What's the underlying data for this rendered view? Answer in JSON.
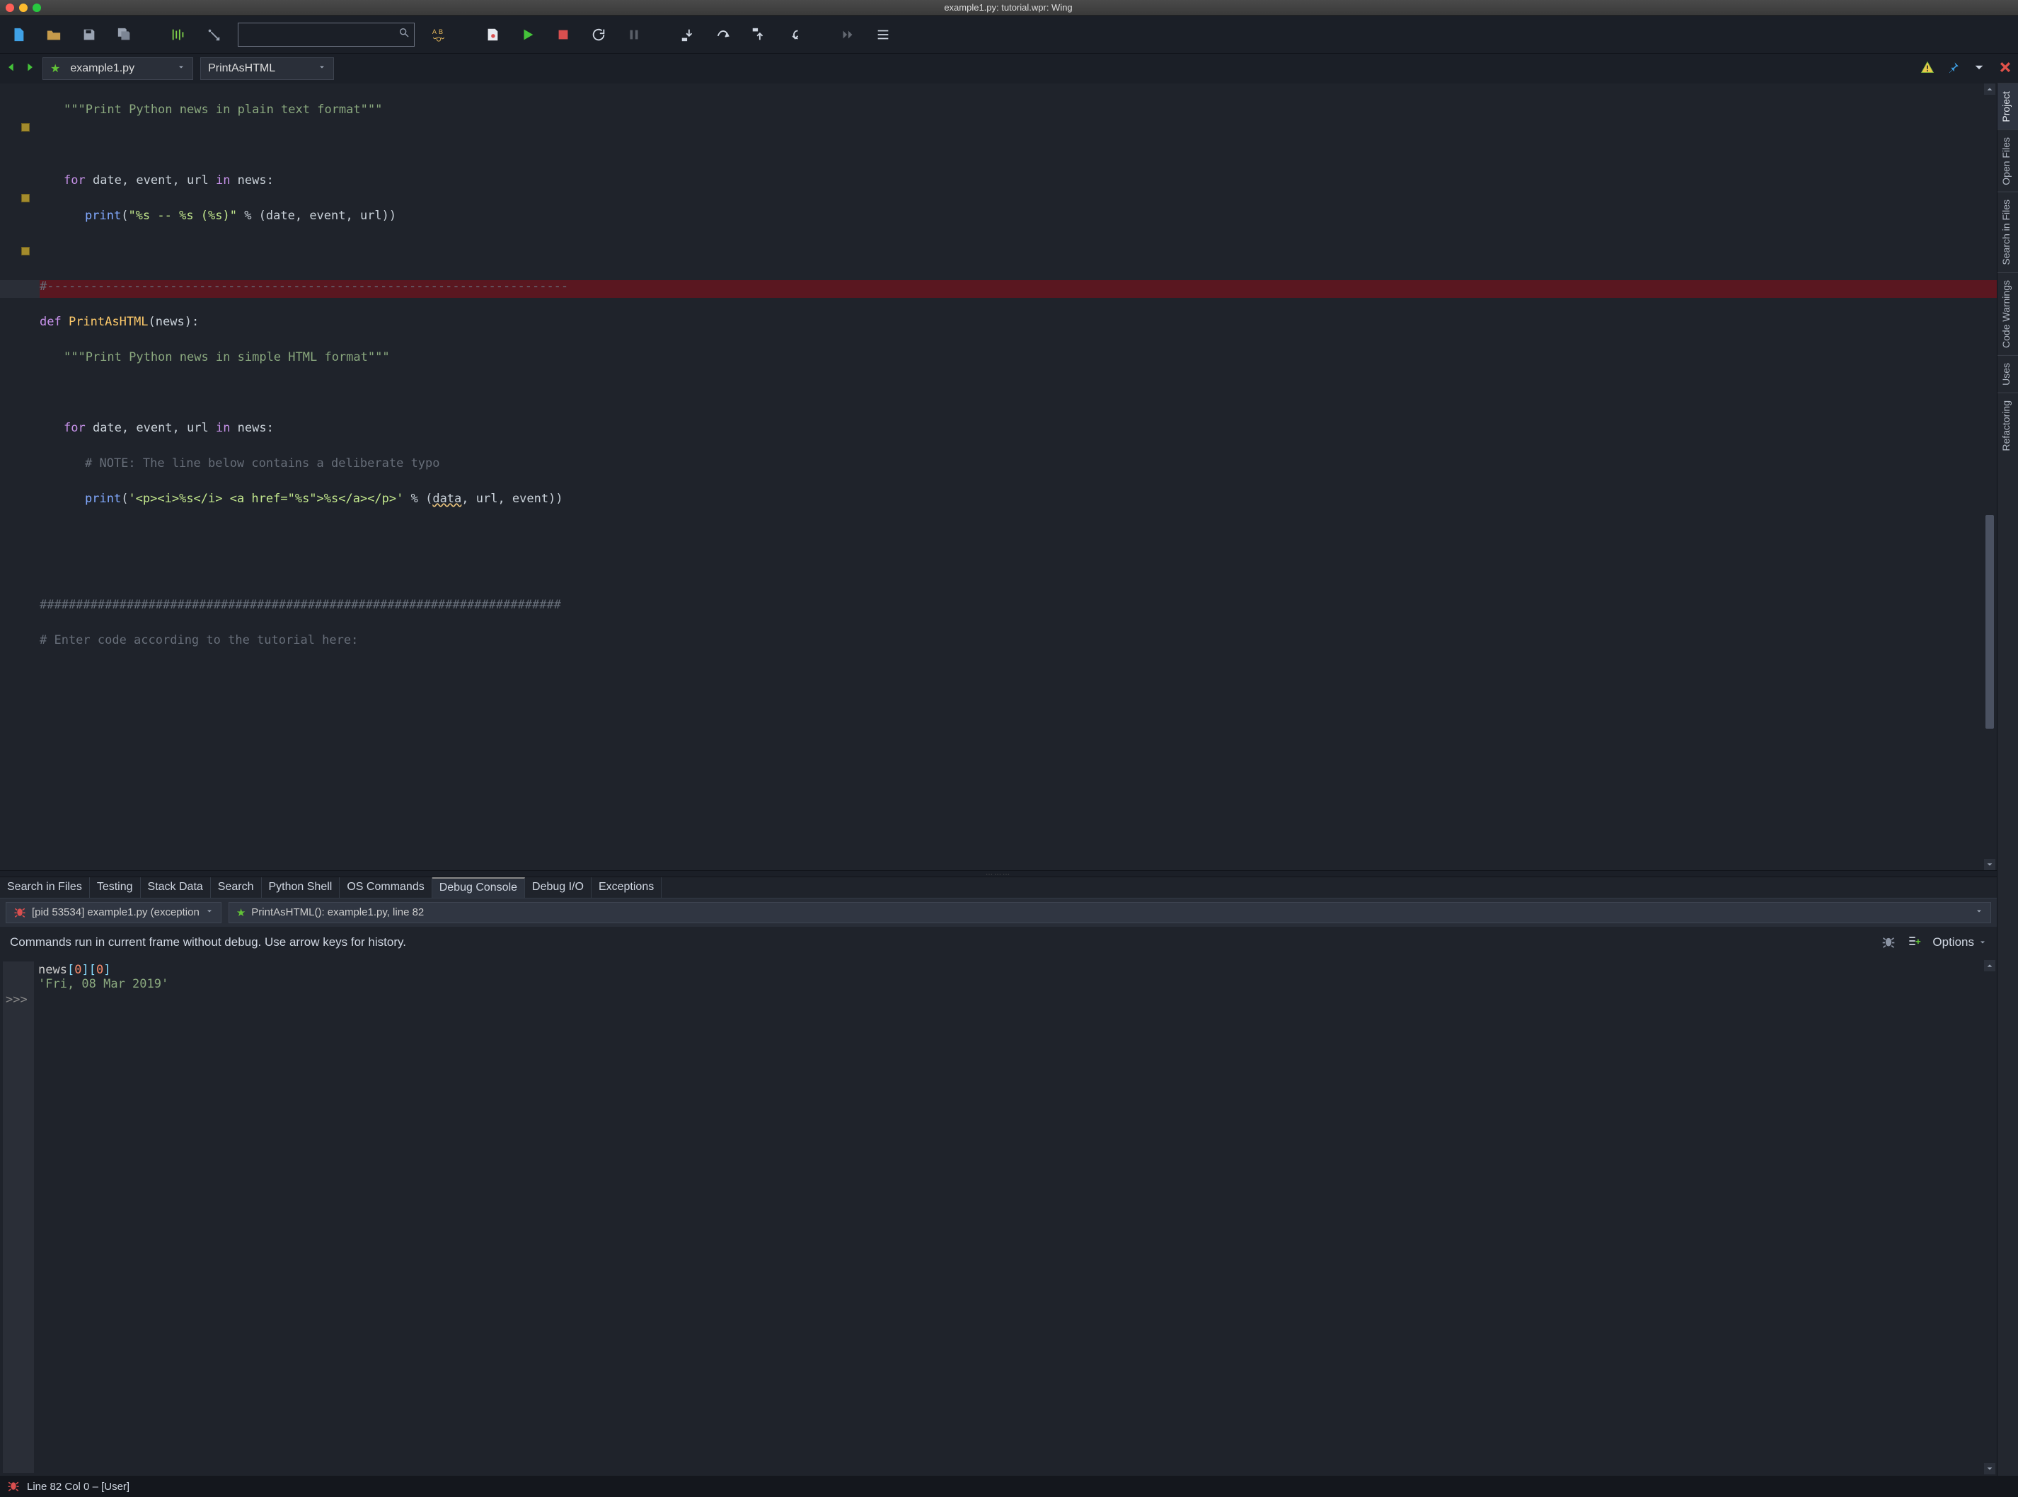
{
  "window": {
    "title": "example1.py: tutorial.wpr: Wing"
  },
  "filetab": {
    "file": "example1.py",
    "symbol": "PrintAsHTML"
  },
  "side_tools": [
    "Project",
    "Open Files",
    "Search in Files",
    "Code Warnings",
    "Uses",
    "Refactoring"
  ],
  "bottom_tabs": [
    "Search in Files",
    "Testing",
    "Stack Data",
    "Search",
    "Python Shell",
    "OS Commands",
    "Debug Console",
    "Debug I/O",
    "Exceptions"
  ],
  "bottom_active": "Debug Console",
  "debug": {
    "process": "[pid 53534] example1.py (exception",
    "frame": "PrintAsHTML(): example1.py, line 82",
    "hint": "Commands run in current frame without debug.  Use arrow keys for history.",
    "options_label": "Options",
    "console_in": "news[0][0]",
    "console_out": "'Fri, 08 Mar 2019'",
    "prompt": ">>>"
  },
  "status": {
    "text": "Line 82 Col 0 – [User]"
  },
  "code": {
    "l1": "\"\"\"Print Python news in plain text format\"\"\"",
    "l3a": "for",
    "l3b": " date, event, url ",
    "l3c": "in",
    "l3d": " news:",
    "l4a": "print",
    "l4b": "(",
    "l4c": "\"%s -- %s (%s)\"",
    "l4d": " % (date, event, url))",
    "l6": "#------------------------------------------------------------------------",
    "l7a": "def ",
    "l7b": "PrintAsHTML",
    "l7c": "(news):",
    "l8": "\"\"\"Print Python news in simple HTML format\"\"\"",
    "l10a": "for",
    "l10b": " date, event, url ",
    "l10c": "in",
    "l10d": " news:",
    "l11": "# NOTE: The line below contains a deliberate typo",
    "l12a": "print",
    "l12b": "(",
    "l12c": "'<p><i>%s</i> <a href=\"%s\">%s</a></p>'",
    "l12d": " % (",
    "l12e": "data",
    "l12f": ", url, event))",
    "l15": "########################################################################",
    "l16": "# Enter code according to the tutorial here:"
  }
}
